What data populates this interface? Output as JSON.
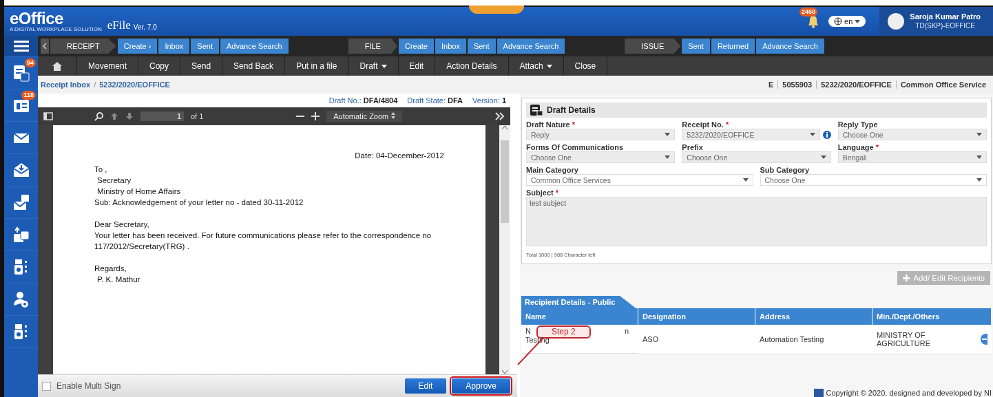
{
  "header": {
    "logo": "eOffice",
    "tagline": "A DIGITAL WORKPLACE SOLUTION",
    "app_name": "eFile",
    "version": "Ver. 7.0",
    "notification_count": "2450",
    "language": "en",
    "user_name": "Saroja Kumar Patro",
    "user_role": "TD(SKP)-EOFFICE"
  },
  "sidebar": [
    {
      "kind": "menu"
    },
    {
      "kind": "receipt",
      "badge": "94"
    },
    {
      "kind": "file",
      "badge": "118"
    },
    {
      "kind": "mail"
    },
    {
      "kind": "inbox"
    },
    {
      "kind": "newmail"
    },
    {
      "kind": "move"
    },
    {
      "kind": "dsc"
    },
    {
      "kind": "user-settings"
    },
    {
      "kind": "dsc"
    }
  ],
  "nav_groups": [
    {
      "label": "RECEIPT",
      "items": [
        "Create ›",
        "Inbox",
        "Sent",
        "Advance Search"
      ]
    },
    {
      "label": "FILE",
      "items": [
        "Create",
        "Inbox",
        "Sent",
        "Advance Search"
      ]
    },
    {
      "label": "ISSUE",
      "items": [
        "Sent",
        "Returned",
        "Advance Search"
      ]
    }
  ],
  "toolbar": [
    {
      "label": "Movement",
      "dropdown": false
    },
    {
      "label": "Copy",
      "dropdown": false
    },
    {
      "label": "Send",
      "dropdown": false
    },
    {
      "label": "Send Back",
      "dropdown": false
    },
    {
      "label": "Put in a file",
      "dropdown": false
    },
    {
      "label": "Draft",
      "dropdown": true
    },
    {
      "label": "Edit",
      "dropdown": false
    },
    {
      "label": "Action Details",
      "dropdown": false
    },
    {
      "label": "Attach",
      "dropdown": true
    },
    {
      "label": "Close",
      "dropdown": false
    }
  ],
  "breadcrumb": [
    "Receipt Inbox",
    "/",
    "5232/2020/EOFFICE"
  ],
  "file_info": [
    "E",
    "5055903",
    "5232/2020/EOFFICE",
    "Common Office Service"
  ],
  "draft_info": [
    {
      "label": "Draft No.:",
      "value": "DFA/4804"
    },
    {
      "label": "Draft State:",
      "value": "DFA"
    },
    {
      "label": "Version:",
      "value": "1"
    }
  ],
  "viewer": {
    "page": "1",
    "page_count": "of 1",
    "zoom": "Automatic Zoom"
  },
  "letter": {
    "date": "Date: 04-December-2012",
    "blocks": [
      [
        {
          "text": "To ,",
          "indent": false
        },
        {
          "text": "Secretary",
          "indent": true
        },
        {
          "text": "Ministry of Home Affairs",
          "indent": true
        },
        {
          "text": "Sub: Acknowledgement of your letter no - dated 30-11-2012",
          "indent": false
        }
      ],
      [
        {
          "text": "Dear Secretary,",
          "indent": false
        },
        {
          "text": "Your letter has been received. For future communications please refer to the correspondence no 117/2012/Secretary(TRG) .",
          "indent": false
        }
      ],
      [
        {
          "text": "Regards,",
          "indent": false
        },
        {
          "text": "P. K. Mathur",
          "indent": true
        }
      ]
    ]
  },
  "bottom_bar": {
    "multi_sign": {
      "label": "Enable Multi Sign",
      "checked": false
    },
    "buttons": [
      {
        "label": "Edit",
        "highlighted": false
      },
      {
        "label": "Approve",
        "highlighted": true
      }
    ]
  },
  "callout": {
    "label": "Step 2"
  },
  "draft_details": {
    "title": "Draft Details",
    "rows": [
      [
        {
          "label": "Draft Nature",
          "mark": "*",
          "value": "Reply",
          "info": false
        },
        {
          "label": "Receipt No.",
          "mark": "*",
          "value": "5232/2020/EOFFICE",
          "info": true
        },
        {
          "label": "Reply Type",
          "value": "Choose One",
          "info": false
        }
      ],
      [
        {
          "label": "Forms Of Communications",
          "value": "Choose One",
          "info": false
        },
        {
          "label": "Prefix",
          "value": "Choose One",
          "info": false
        },
        {
          "label": "Language",
          "mark": "*",
          "value": "Bengali",
          "info": false
        }
      ],
      [
        {
          "label": "Main Category",
          "value": "Common Office Services",
          "info": false
        },
        {
          "label": "Sub Category",
          "value": "Choose One",
          "info": false
        }
      ]
    ],
    "subject": {
      "label": "Subject",
      "mark": "*",
      "value": "test subject"
    },
    "char_count": "Total 1000 | 988 Character left"
  },
  "add_recipients": "Add/ Edit Recipients",
  "recipients": {
    "tab": "Recipient Details - Public",
    "columns": [
      "Name",
      "Designation",
      "Address",
      "Min./Dept./Others"
    ],
    "rows": [
      {
        "fragments": [
          "N",
          "n"
        ],
        "cells": [
          "Testing",
          "ASO",
          "Automation Testing",
          "MINISTRY OF AGRICULTURE"
        ]
      }
    ]
  },
  "copyright": "Copyright © 2020, designed and developed by NI"
}
